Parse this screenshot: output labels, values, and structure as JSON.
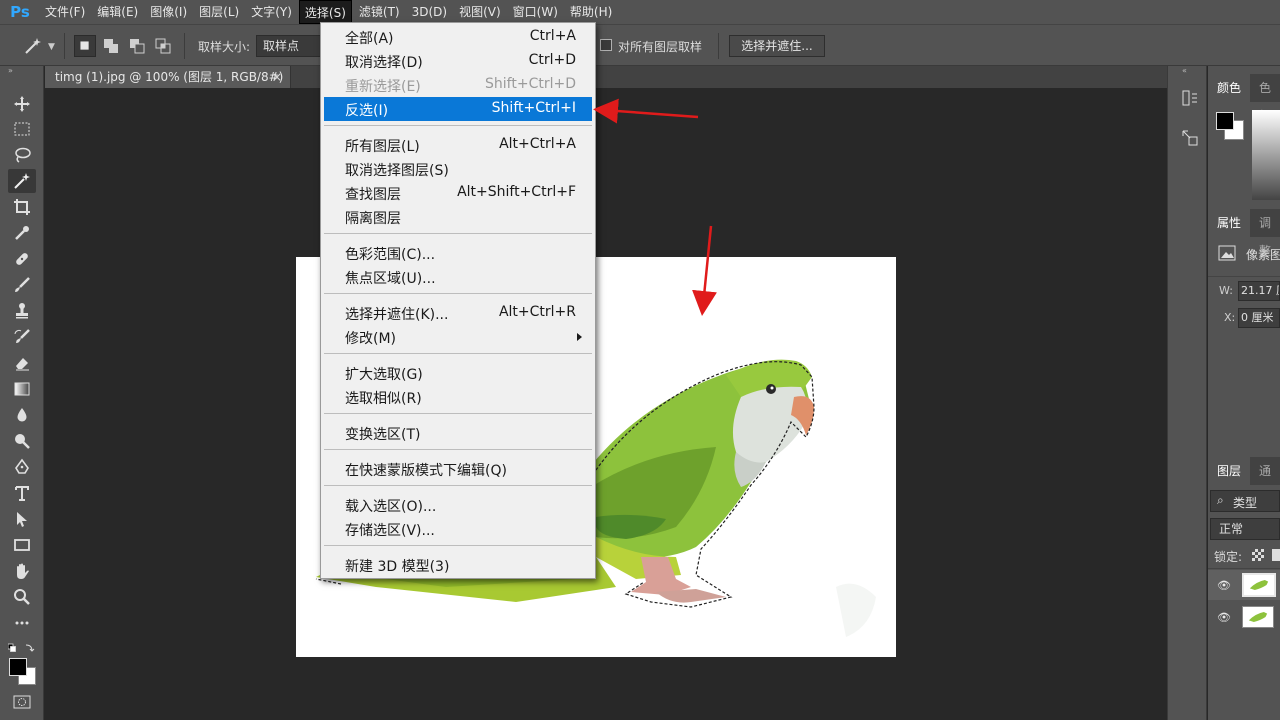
{
  "app": {
    "logo": "Ps",
    "menus": [
      "文件(F)",
      "编辑(E)",
      "图像(I)",
      "图层(L)",
      "文字(Y)",
      "选择(S)",
      "滤镜(T)",
      "3D(D)",
      "视图(V)",
      "窗口(W)",
      "帮助(H)"
    ],
    "active_menu": "选择(S)"
  },
  "options": {
    "sample_size_label": "取样大小:",
    "sample_size_value": "取样点",
    "sample_all_layers_label": "对所有图层取样",
    "select_and_mask_button": "选择并遮住..."
  },
  "document": {
    "tab_title": "timg (1).jpg @ 100% (图层 1, RGB/8#) *",
    "close_symbol": "×"
  },
  "select_menu": {
    "items": [
      {
        "label": "全部(A)",
        "shortcut": "Ctrl+A",
        "state": "normal"
      },
      {
        "label": "取消选择(D)",
        "shortcut": "Ctrl+D",
        "state": "normal"
      },
      {
        "label": "重新选择(E)",
        "shortcut": "Shift+Ctrl+D",
        "state": "disabled"
      },
      {
        "label": "反选(I)",
        "shortcut": "Shift+Ctrl+I",
        "state": "highlighted"
      },
      {
        "label": "所有图层(L)",
        "shortcut": "Alt+Ctrl+A",
        "state": "normal"
      },
      {
        "label": "取消选择图层(S)",
        "shortcut": "",
        "state": "normal"
      },
      {
        "label": "查找图层",
        "shortcut": "Alt+Shift+Ctrl+F",
        "state": "normal"
      },
      {
        "label": "隔离图层",
        "shortcut": "",
        "state": "normal"
      },
      {
        "label": "色彩范围(C)...",
        "shortcut": "",
        "state": "normal"
      },
      {
        "label": "焦点区域(U)...",
        "shortcut": "",
        "state": "normal"
      },
      {
        "label": "选择并遮住(K)...",
        "shortcut": "Alt+Ctrl+R",
        "state": "normal"
      },
      {
        "label": "修改(M)",
        "shortcut": "",
        "state": "submenu"
      },
      {
        "label": "扩大选取(G)",
        "shortcut": "",
        "state": "normal"
      },
      {
        "label": "选取相似(R)",
        "shortcut": "",
        "state": "normal"
      },
      {
        "label": "变换选区(T)",
        "shortcut": "",
        "state": "normal"
      },
      {
        "label": "在快速蒙版模式下编辑(Q)",
        "shortcut": "",
        "state": "normal"
      },
      {
        "label": "载入选区(O)...",
        "shortcut": "",
        "state": "normal"
      },
      {
        "label": "存储选区(V)...",
        "shortcut": "",
        "state": "normal"
      },
      {
        "label": "新建 3D 模型(3)",
        "shortcut": "",
        "state": "normal"
      }
    ]
  },
  "panels": {
    "color_tab": "颜色",
    "swatches_tab": "色板",
    "properties_tab": "属性",
    "adjustments_tab": "调整",
    "pixel_layer_label": "像素图",
    "w_label": "W:",
    "w_value": "21.17 厘",
    "x_label": "X:",
    "x_value": "0 厘米",
    "layers_tab": "图层",
    "channels_tab": "通道",
    "kind_filter": "类型",
    "blend_mode": "正常",
    "lock_label": "锁定:"
  },
  "colors": {
    "accent_highlight": "#0a78d7",
    "annotation_arrow": "#e01b1b",
    "ps_logo": "#31a8ff"
  }
}
